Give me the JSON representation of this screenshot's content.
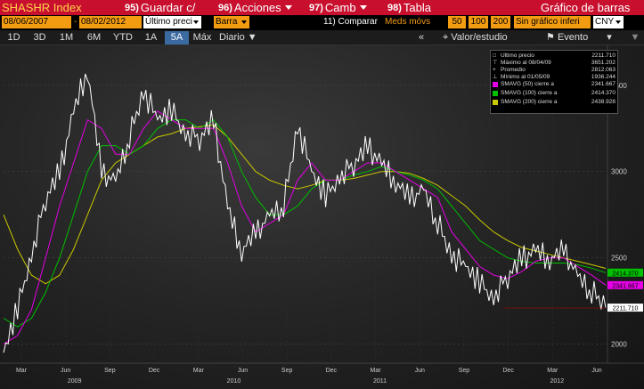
{
  "toolbar": {
    "ticker": "SHASHR Index",
    "buttons": [
      {
        "key": "95)",
        "label": "Guardar c/"
      },
      {
        "key": "96)",
        "label": "Acciones"
      },
      {
        "key": "97)",
        "label": "Camb"
      },
      {
        "key": "98)",
        "label": "Tabla"
      }
    ],
    "chart_title": "Gráfico de barras"
  },
  "params": {
    "start_date": "08/06/2007",
    "end_date": "08/02/2012",
    "field": "Último preci",
    "chart_type": "Barra",
    "compare": "11) Comparar",
    "meds_label": "Meds móvs",
    "ma1": "50",
    "ma2": "100",
    "ma3": "200",
    "lower_chart": "Sin gráfico inferi",
    "currency": "CNY"
  },
  "periods": {
    "tabs": [
      "1D",
      "3D",
      "1M",
      "6M",
      "YTD",
      "1A",
      "5A",
      "Máx"
    ],
    "active": "5A",
    "frequency": "Diario",
    "collapse": "«",
    "value_study": "Valor/estudio",
    "event": "Evento"
  },
  "legend": {
    "rows": [
      {
        "name": "Último precio",
        "value": "2211.710",
        "color": "#ffffff"
      },
      {
        "name": "Máximo al 08/04/09",
        "value": "3651.202",
        "color": "#ffffff"
      },
      {
        "name": "Promedio",
        "value": "2812.063",
        "color": "#ffffff"
      },
      {
        "name": "Mínimo al 01/05/09",
        "value": "1936.244",
        "color": "#ffffff"
      },
      {
        "name": "SMAVG (50) cierre a",
        "value": "2341.667",
        "color": "#e600e6"
      },
      {
        "name": "SMAVG (100) cierre a",
        "value": "2414.370",
        "color": "#00c000"
      },
      {
        "name": "SMAVG (200) cierre a",
        "value": "2438.928",
        "color": "#c8c800"
      }
    ]
  },
  "chart_data": {
    "type": "line",
    "x": [
      "2009-01",
      "2009-02",
      "2009-03",
      "2009-04",
      "2009-05",
      "2009-06",
      "2009-07",
      "2009-08",
      "2009-09",
      "2009-10",
      "2009-11",
      "2009-12",
      "2010-01",
      "2010-02",
      "2010-03",
      "2010-04",
      "2010-05",
      "2010-06",
      "2010-07",
      "2010-08",
      "2010-09",
      "2010-10",
      "2010-11",
      "2010-12",
      "2011-01",
      "2011-02",
      "2011-03",
      "2011-04",
      "2011-05",
      "2011-06",
      "2011-07",
      "2011-08",
      "2011-09",
      "2011-10",
      "2011-11",
      "2011-12",
      "2012-01",
      "2012-02",
      "2012-03",
      "2012-04",
      "2012-05",
      "2012-06",
      "2012-07",
      "2012-08"
    ],
    "series": [
      {
        "name": "Último precio",
        "color": "#ffffff",
        "values": [
          1950,
          2200,
          2500,
          2850,
          3000,
          3350,
          3600,
          3000,
          2950,
          3200,
          3450,
          3300,
          3350,
          3200,
          3200,
          3300,
          2800,
          2550,
          2650,
          2750,
          2800,
          3250,
          3000,
          2850,
          2950,
          3050,
          3150,
          3050,
          2950,
          2850,
          2900,
          2700,
          2500,
          2450,
          2350,
          2250,
          2400,
          2500,
          2550,
          2500,
          2550,
          2400,
          2300,
          2212
        ]
      },
      {
        "name": "SMAVG (50) cierre a",
        "color": "#e600e6",
        "values": [
          2000,
          2050,
          2200,
          2500,
          2800,
          3050,
          3300,
          3250,
          3100,
          3100,
          3250,
          3350,
          3300,
          3250,
          3250,
          3250,
          3050,
          2800,
          2650,
          2700,
          2750,
          2950,
          3050,
          2950,
          2950,
          3000,
          3050,
          3050,
          3000,
          2950,
          2900,
          2850,
          2650,
          2550,
          2450,
          2400,
          2380,
          2420,
          2480,
          2500,
          2500,
          2450,
          2400,
          2342
        ]
      },
      {
        "name": "SMAVG (100) cierre a",
        "color": "#00c000",
        "values": [
          2150,
          2100,
          2150,
          2300,
          2500,
          2750,
          3000,
          3150,
          3150,
          3100,
          3150,
          3250,
          3300,
          3300,
          3250,
          3300,
          3200,
          3000,
          2850,
          2750,
          2750,
          2800,
          2900,
          2950,
          2950,
          2980,
          3000,
          3030,
          3000,
          2980,
          2950,
          2900,
          2800,
          2700,
          2600,
          2550,
          2500,
          2480,
          2470,
          2470,
          2470,
          2460,
          2440,
          2414
        ]
      },
      {
        "name": "SMAVG (200) cierre a",
        "color": "#c8c800",
        "values": [
          2750,
          2550,
          2400,
          2350,
          2400,
          2550,
          2750,
          2950,
          3050,
          3100,
          3150,
          3200,
          3220,
          3250,
          3260,
          3270,
          3200,
          3100,
          3000,
          2950,
          2920,
          2900,
          2920,
          2950,
          2950,
          2960,
          2980,
          3000,
          3000,
          2990,
          2960,
          2920,
          2860,
          2800,
          2720,
          2650,
          2600,
          2560,
          2540,
          2520,
          2500,
          2480,
          2460,
          2439
        ]
      }
    ],
    "y_ticks": [
      2000,
      2500,
      3000,
      3500
    ],
    "ylim": [
      1900,
      3700
    ],
    "x_tick_labels": [
      "Mar",
      "Jun",
      "Sep",
      "Dec",
      "Mar",
      "Jun",
      "Sep",
      "Dec",
      "Mar",
      "Jun",
      "Sep",
      "Dec",
      "Mar",
      "Jun"
    ],
    "year_labels": [
      "2009",
      "2010",
      "2011",
      "2012"
    ],
    "price_tags": [
      {
        "value": "2414.370",
        "y": 2414.37,
        "color": "#00c000",
        "text_color": "#000"
      },
      {
        "value": "2341.667",
        "y": 2341.667,
        "color": "#e600e6",
        "text_color": "#000"
      },
      {
        "value": "2211.710",
        "y": 2211.71,
        "color": "#ffffff",
        "text_color": "#000"
      }
    ],
    "grid": true,
    "legend_position": "top-right"
  }
}
